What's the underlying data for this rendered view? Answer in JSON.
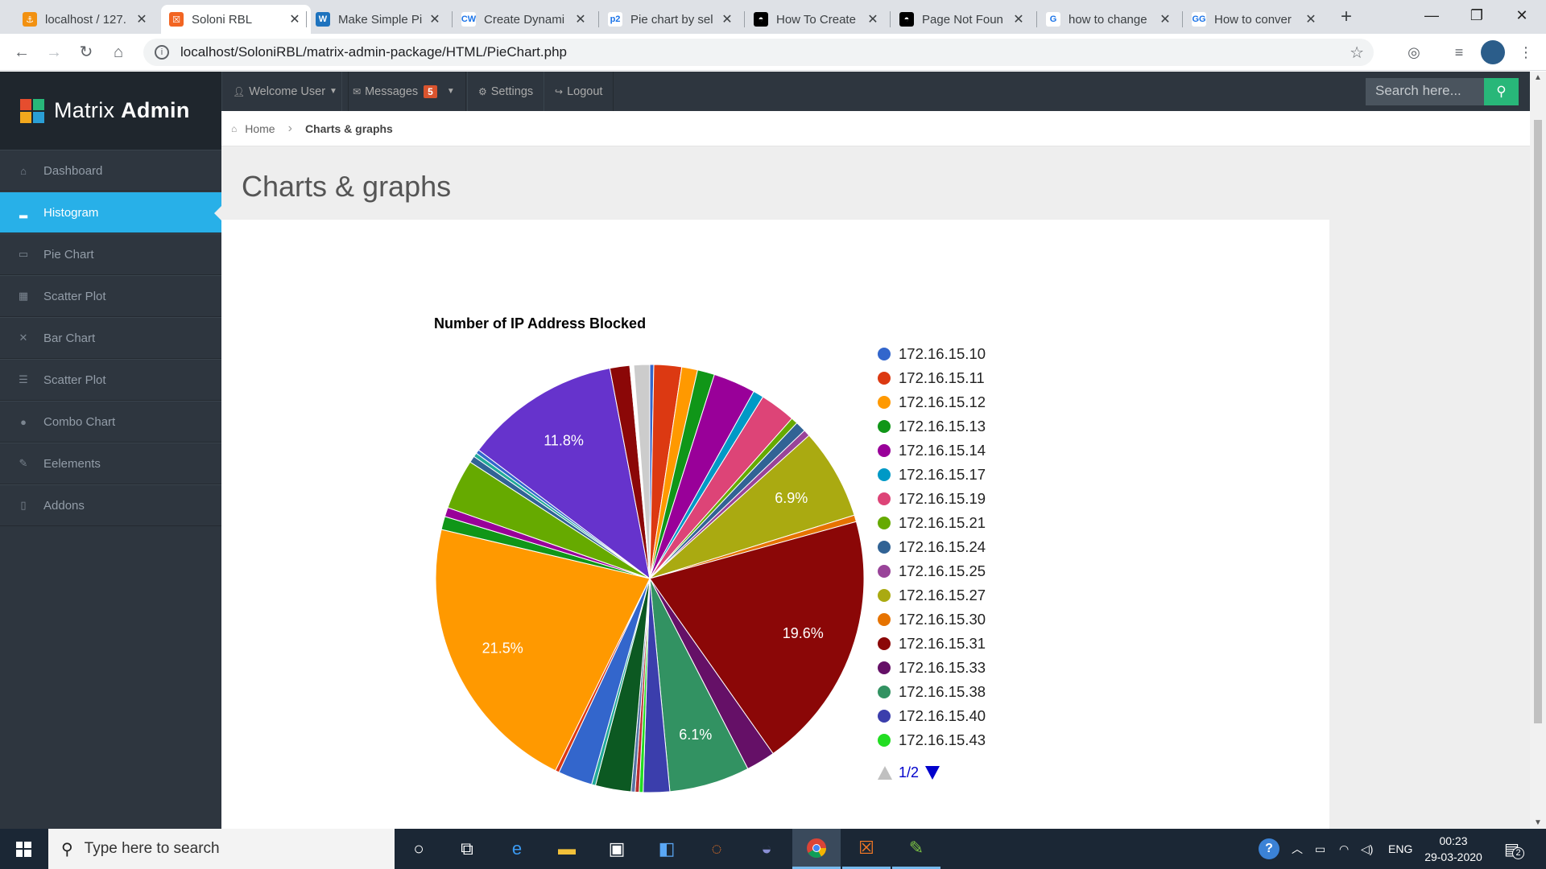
{
  "browser": {
    "tabs": [
      {
        "title": "localhost / 127.",
        "color": "#f29111",
        "glyph": "⚓"
      },
      {
        "title": "Soloni RBL",
        "color": "#f26522",
        "glyph": "☒"
      },
      {
        "title": "Make Simple Pi",
        "color": "#1e73be",
        "glyph": "W"
      },
      {
        "title": "Create Dynami",
        "color": "#ffffff",
        "glyph": "CW"
      },
      {
        "title": "Pie chart by sel",
        "color": "#ffffff",
        "glyph": "p2"
      },
      {
        "title": "How To Create",
        "color": "#000000",
        "glyph": "◓"
      },
      {
        "title": "Page Not Foun",
        "color": "#000000",
        "glyph": "◓"
      },
      {
        "title": "how to change",
        "color": "#ffffff",
        "glyph": "G"
      },
      {
        "title": "How to conver",
        "color": "#ffffff",
        "glyph": "GG"
      }
    ],
    "url": "localhost/SoloniRBL/matrix-admin-package/HTML/PieChart.php"
  },
  "app": {
    "brand_light": "Matrix",
    "brand_bold": "Admin",
    "topnav": {
      "welcome": "Welcome User",
      "messages": "Messages",
      "messages_count": "5",
      "settings": "Settings",
      "logout": "Logout",
      "search_placeholder": "Search here..."
    },
    "sidebar": [
      {
        "label": "Dashboard",
        "icon": "home-icon",
        "glyph": "⌂",
        "active": false
      },
      {
        "label": "Histogram",
        "icon": "signal-icon",
        "glyph": "▂",
        "active": true
      },
      {
        "label": "Pie Chart",
        "icon": "inbox-icon",
        "glyph": "▭",
        "active": false
      },
      {
        "label": "Scatter Plot",
        "icon": "grid-icon",
        "glyph": "▦",
        "active": false
      },
      {
        "label": "Bar Chart",
        "icon": "fullscreen-icon",
        "glyph": "✕",
        "active": false
      },
      {
        "label": "Scatter Plot",
        "icon": "list-icon",
        "glyph": "☰",
        "active": false
      },
      {
        "label": "Combo Chart",
        "icon": "tint-icon",
        "glyph": "●",
        "active": false
      },
      {
        "label": "Eelements",
        "icon": "pencil-icon",
        "glyph": "✎",
        "active": false
      },
      {
        "label": "Addons",
        "icon": "file-icon",
        "glyph": "▯",
        "active": false
      }
    ],
    "breadcrumb": {
      "home": "Home",
      "current": "Charts & graphs"
    },
    "page_title": "Charts & graphs"
  },
  "chart_data": {
    "type": "pie",
    "title": "Number of IP Address Blocked",
    "legend_position": "right",
    "legend_page": "1/2",
    "slices": [
      {
        "label": "172.16.15.10",
        "value": 0.3,
        "color": "#3366cc",
        "shown_label": ""
      },
      {
        "label": "172.16.15.11",
        "value": 2.1,
        "color": "#dc3912",
        "shown_label": ""
      },
      {
        "label": "172.16.15.12",
        "value": 1.2,
        "color": "#ff9900",
        "shown_label": ""
      },
      {
        "label": "172.16.15.13",
        "value": 1.3,
        "color": "#109618",
        "shown_label": ""
      },
      {
        "label": "172.16.15.14",
        "value": 3.2,
        "color": "#990099",
        "shown_label": ""
      },
      {
        "label": "172.16.15.17",
        "value": 0.8,
        "color": "#0099c6",
        "shown_label": ""
      },
      {
        "label": "172.16.15.19",
        "value": 2.7,
        "color": "#dd4477",
        "shown_label": ""
      },
      {
        "label": "172.16.15.21",
        "value": 0.5,
        "color": "#66aa00",
        "shown_label": ""
      },
      {
        "label": "172.16.15.24",
        "value": 0.8,
        "color": "#316395",
        "shown_label": ""
      },
      {
        "label": "172.16.15.25",
        "value": 0.5,
        "color": "#994499",
        "shown_label": ""
      },
      {
        "label": "172.16.15.27",
        "value": 6.9,
        "color": "#aaaa11",
        "shown_label": "6.9%"
      },
      {
        "label": "172.16.15.30",
        "value": 0.5,
        "color": "#e67300",
        "shown_label": ""
      },
      {
        "label": "172.16.15.31",
        "value": 19.6,
        "color": "#8b0707",
        "shown_label": "19.6%"
      },
      {
        "label": "172.16.15.33",
        "value": 2.2,
        "color": "#651067",
        "shown_label": ""
      },
      {
        "label": "172.16.15.38",
        "value": 6.1,
        "color": "#329262",
        "shown_label": "6.1%"
      },
      {
        "label": "172.16.15.40",
        "value": 2.0,
        "color": "#3b3eac",
        "shown_label": ""
      },
      {
        "label": "172.16.15.43",
        "value": 0.3,
        "color": "#22dd22",
        "shown_label": ""
      },
      {
        "label": "",
        "value": 0.3,
        "color": "#b82e2e",
        "shown_label": ""
      },
      {
        "label": "",
        "value": 0.3,
        "color": "#5574a6",
        "shown_label": ""
      },
      {
        "label": "",
        "value": 2.7,
        "color": "#0c5922",
        "shown_label": ""
      },
      {
        "label": "",
        "value": 0.3,
        "color": "#22aa99",
        "shown_label": ""
      },
      {
        "label": "",
        "value": 2.6,
        "color": "#3366cc",
        "shown_label": ""
      },
      {
        "label": "",
        "value": 0.3,
        "color": "#dc3912",
        "shown_label": ""
      },
      {
        "label": "",
        "value": 21.5,
        "color": "#ff9900",
        "shown_label": "21.5%"
      },
      {
        "label": "",
        "value": 1.0,
        "color": "#109618",
        "shown_label": ""
      },
      {
        "label": "",
        "value": 0.7,
        "color": "#990099",
        "shown_label": ""
      },
      {
        "label": "",
        "value": 3.8,
        "color": "#66aa00",
        "shown_label": ""
      },
      {
        "label": "",
        "value": 0.5,
        "color": "#316395",
        "shown_label": ""
      },
      {
        "label": "",
        "value": 0.3,
        "color": "#22aa99",
        "shown_label": ""
      },
      {
        "label": "",
        "value": 0.3,
        "color": "#3366cc",
        "shown_label": ""
      },
      {
        "label": "",
        "value": 11.8,
        "color": "#6633cc",
        "shown_label": "11.8%"
      },
      {
        "label": "",
        "value": 1.5,
        "color": "#8b0707",
        "shown_label": ""
      },
      {
        "label": "",
        "value": 0.3,
        "color": "#ffffff",
        "shown_label": ""
      },
      {
        "label": "",
        "value": 1.2,
        "color": "#cccccc",
        "shown_label": ""
      }
    ]
  },
  "taskbar": {
    "search_placeholder": "Type here to search",
    "language": "ENG",
    "time": "00:23",
    "date": "29-03-2020",
    "notifications": "2"
  }
}
